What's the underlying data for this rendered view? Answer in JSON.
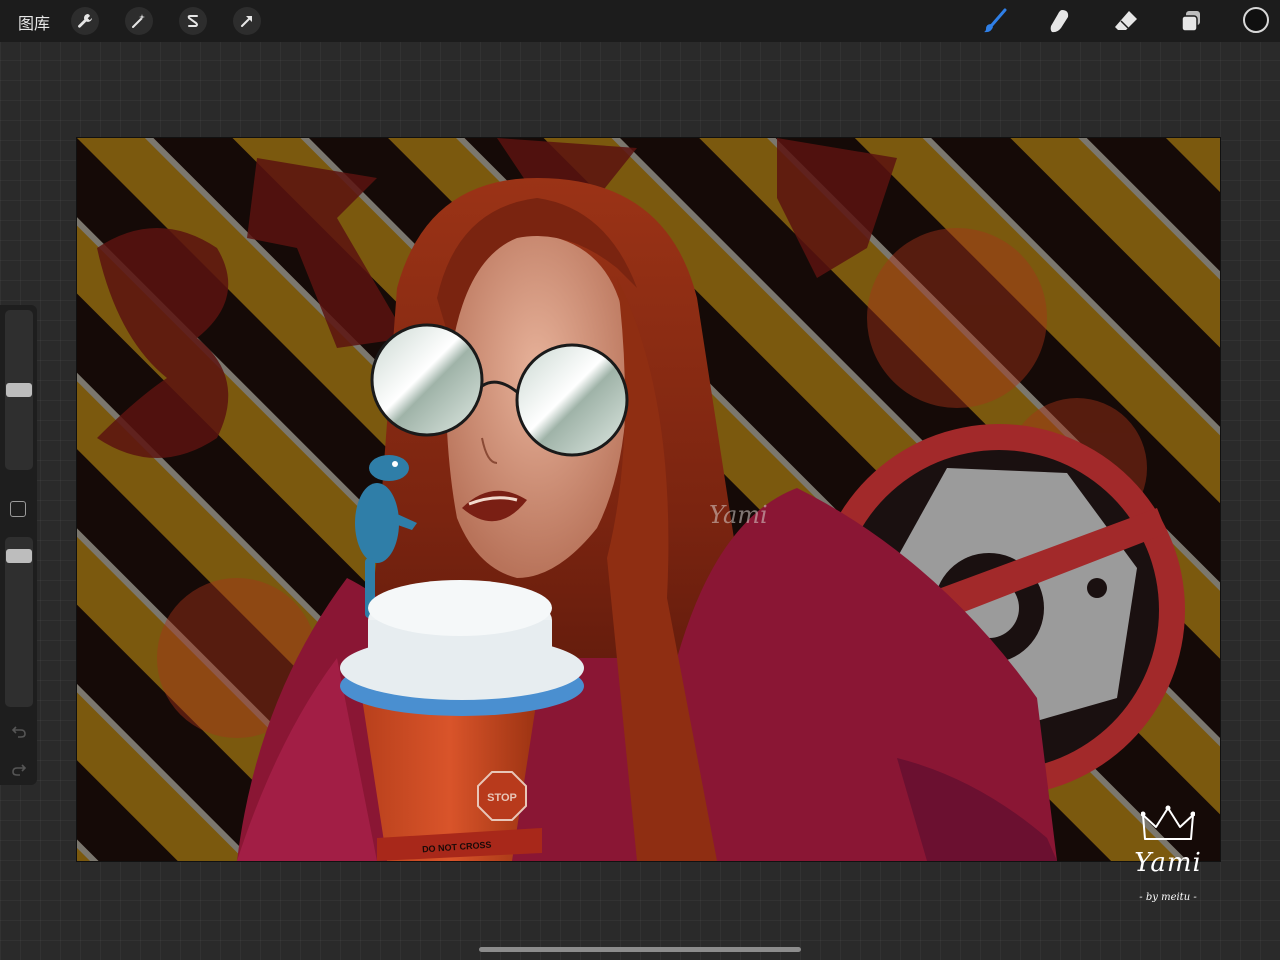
{
  "topbar": {
    "gallery_label": "图库",
    "left_tools": [
      {
        "name": "actions",
        "icon": "wrench-icon"
      },
      {
        "name": "adjustments",
        "icon": "magic-wand-icon"
      },
      {
        "name": "selection",
        "icon": "selection-s-icon"
      },
      {
        "name": "transform",
        "icon": "arrow-cursor-icon"
      }
    ],
    "right_tools": [
      {
        "name": "brush",
        "icon": "brush-icon",
        "active": true
      },
      {
        "name": "smudge",
        "icon": "smudge-icon",
        "active": false
      },
      {
        "name": "eraser",
        "icon": "eraser-icon",
        "active": false
      },
      {
        "name": "layers",
        "icon": "layers-icon",
        "active": false
      }
    ],
    "current_color": "#101010",
    "accent_color": "#2f7fe6"
  },
  "sidebar": {
    "brush_size_level": 0.5,
    "opacity_level": 0.92,
    "modify_icon": "square-modify-icon",
    "undo_icon": "undo-icon",
    "redo_icon": "redo-icon"
  },
  "artwork": {
    "watermark": "Yami",
    "cup_sign": "STOP",
    "tape_text": "DO NOT CROSS",
    "signature_name": "Yami",
    "signature_by": "- by meitu -"
  }
}
